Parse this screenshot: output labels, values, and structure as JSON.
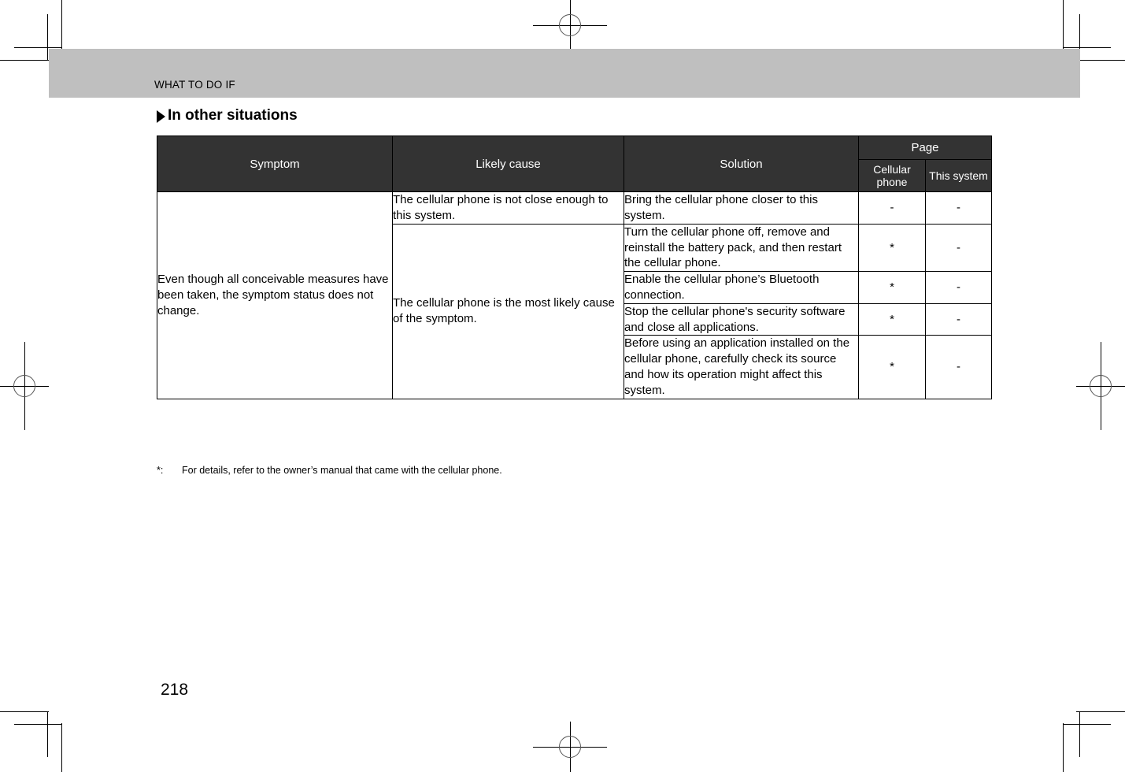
{
  "page": {
    "running_header": "WHAT TO DO IF",
    "section_heading": "In other situations",
    "page_number": "218",
    "footnote_marker": "*:",
    "footnote_text": "For details, refer to the owner’s manual that came with the cellular phone.",
    "colors": {
      "header_band": "#bfbfbf",
      "table_header": "#333333",
      "table_header_text": "#ffffff",
      "body_text": "#000000",
      "border": "#000000"
    }
  },
  "table": {
    "headers": {
      "symptom": "Symptom",
      "likely_cause": "Likely cause",
      "solution": "Solution",
      "page_group": "Page",
      "cellular_phone": "Cellular phone",
      "this_system": "This system"
    },
    "rows": [
      {
        "symptom": "Even though all conceivable measures have been taken, the symptom status does not change.",
        "likely_cause": "The cellular phone is not close enough to this system.",
        "solution": "Bring the cellular phone closer to this system.",
        "cellular_phone": "-",
        "this_system": "-"
      },
      {
        "likely_cause": "The cellular phone is the most likely cause of the symptom.",
        "solution": "Turn the cellular phone off, remove and reinstall the battery pack, and then restart the cellular phone.",
        "cellular_phone": "*",
        "this_system": "-"
      },
      {
        "solution": "Enable the cellular phone’s Bluetooth connection.",
        "cellular_phone": "*",
        "this_system": "-"
      },
      {
        "solution": "Stop the cellular phone's security software and close all applications.",
        "cellular_phone": "*",
        "this_system": "-"
      },
      {
        "solution": "Before using an application installed on the cellular phone, carefully check its source and how its operation might affect this system.",
        "cellular_phone": "*",
        "this_system": "-"
      }
    ]
  }
}
